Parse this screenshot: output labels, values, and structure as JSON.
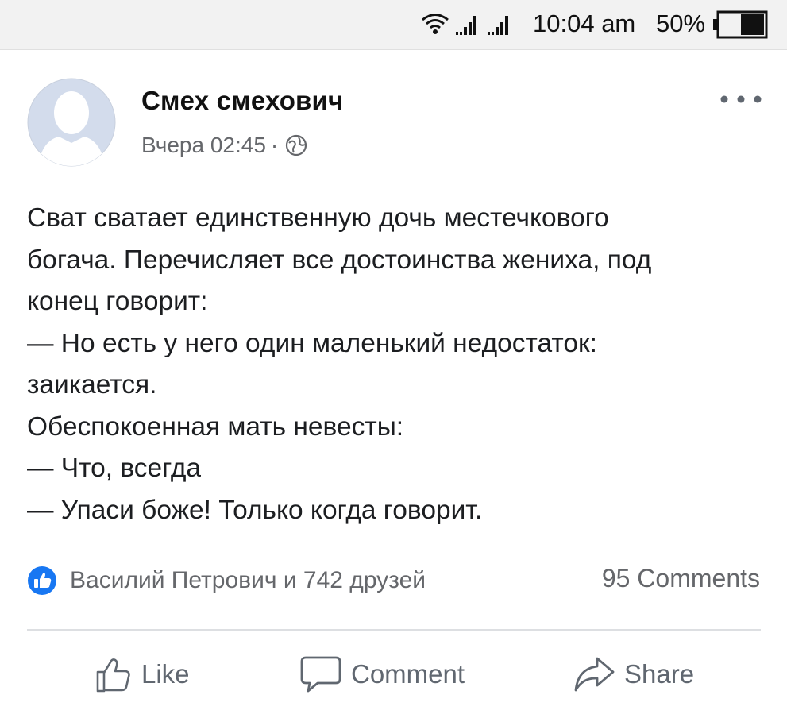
{
  "status_bar": {
    "time": "10:04 am",
    "battery_percent": "50%",
    "battery_level": 0.5
  },
  "post": {
    "author": "Смех смехович",
    "timestamp": "Вчера 02:45",
    "separator": "·",
    "privacy_icon": "globe-icon",
    "text_lines": [
      "Сват сватает единственную дочь местечкового",
      "богача. Перечисляет все достоинства жениха, под",
      "конец говорит:",
      "— Но есть у него один маленький недостаток:",
      "заикается.",
      "Обеспокоенная мать невесты:",
      "— Что, всегда",
      "— Упаси боже! Только когда говорит."
    ],
    "reactions_text": "Василий Петрович и 742 друзей",
    "comments_count": "95 Comments"
  },
  "actions": {
    "like": "Like",
    "comment": "Comment",
    "share": "Share"
  },
  "colors": {
    "accent": "#1877f2",
    "secondary_text": "#65676b",
    "status_bar_bg": "#f2f2f2"
  }
}
